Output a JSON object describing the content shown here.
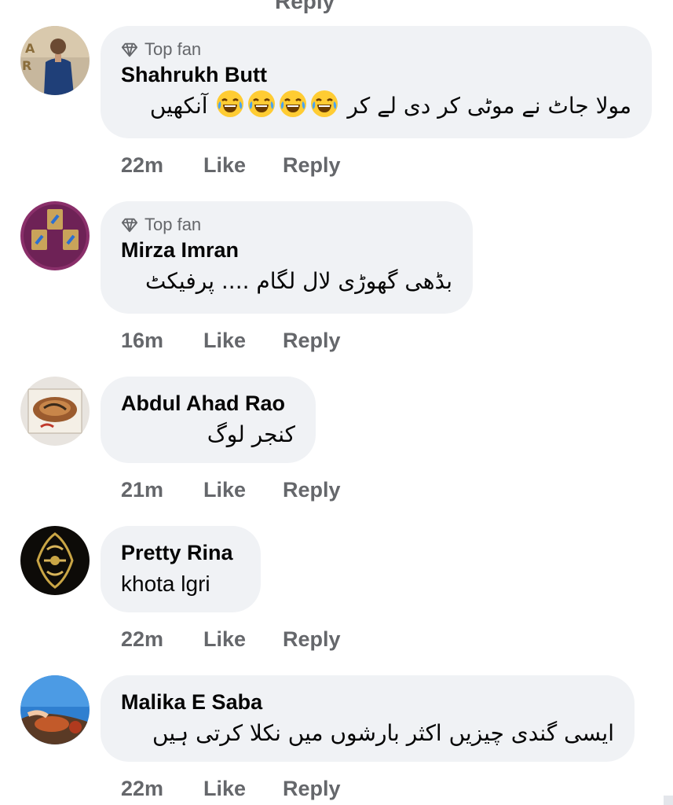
{
  "top_partial": "Reply",
  "comments": [
    {
      "badge": "Top fan",
      "name": "Shahrukh Butt",
      "text": "مولا جاٹ نے موٹی کر دی لے کر 😂😂😂😂آنکھیں",
      "text_before_emoji": "مولا جاٹ نے موٹی کر دی لے کر",
      "text_after_emoji": "آنکھیں",
      "emoji": "face-with-tears-of-joy",
      "emoji_count": 4,
      "time": "22m",
      "like": "Like",
      "reply": "Reply"
    },
    {
      "badge": "Top fan",
      "name": "Mirza Imran",
      "text": "بڈھی گھوڑی لال لگام .... پرفیکٹ",
      "time": "16m",
      "like": "Like",
      "reply": "Reply"
    },
    {
      "name": "Abdul Ahad Rao",
      "text": "کنجر لوگ",
      "time": "21m",
      "like": "Like",
      "reply": "Reply"
    },
    {
      "name": "Pretty Rina",
      "text": "khota lgri",
      "time": "22m",
      "like": "Like",
      "reply": "Reply"
    },
    {
      "name": "Malika E Saba",
      "text": "ایسی گندی چیزیں اکثر بارشوں میں نکلا کرتی ہیں",
      "time": "22m",
      "like": "Like",
      "reply": "Reply"
    }
  ],
  "colors": {
    "bubble": "#f0f2f5",
    "meta_text": "#65676b",
    "primary_text": "#050505",
    "background": "#ffffff"
  }
}
